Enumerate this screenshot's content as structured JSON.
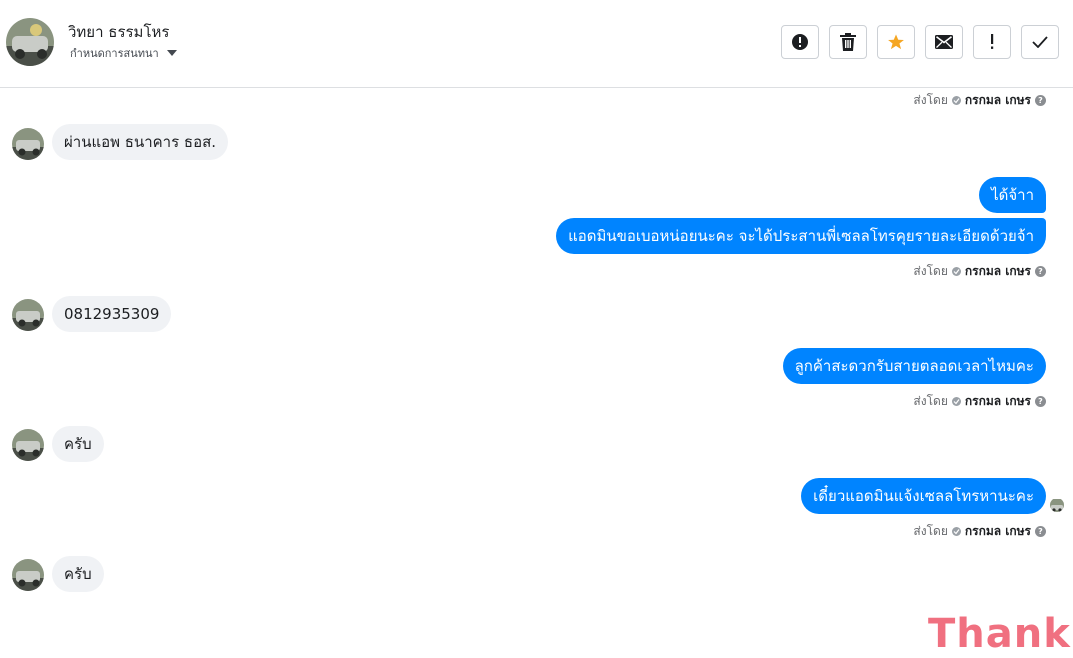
{
  "header": {
    "contact_name": "วิทยา ธรรมโหร",
    "subtitle": "กำหนดการสนทนา",
    "buttons": [
      {
        "name": "report-button",
        "icon": "alert-circle-icon"
      },
      {
        "name": "delete-button",
        "icon": "trash-icon"
      },
      {
        "name": "star-button",
        "icon": "star-icon"
      },
      {
        "name": "mark-unread-button",
        "icon": "envelope-icon"
      },
      {
        "name": "important-button",
        "icon": "exclamation-icon"
      },
      {
        "name": "mark-done-button",
        "icon": "check-icon"
      }
    ]
  },
  "sent_by": {
    "prefix": "ส่งโดย",
    "agent": "กรกมล เกษร",
    "help": "?"
  },
  "messages": {
    "m1": "ผ่านแอพ ธนาคาร ธอส.",
    "m2": "ได้จ้าา",
    "m3": "แอดมินขอเบอหน่อยนะคะ  จะได้ประสานพี่เซลลโทรคุยรายละเอียดด้วยจ้า",
    "m4": "0812935309",
    "m5": "ลูกค้าสะดวกรับสายตลอดเวลาไหมคะ",
    "m6": "ครับ",
    "m7": "เดี๋ยวแอดมินแจ้งเซลลโทรหานะคะ",
    "m8": "ครับ"
  },
  "sticker": {
    "text": "Thank"
  },
  "colors": {
    "outgoing": "#0084ff",
    "incoming": "#f0f2f5",
    "star": "#f5a623",
    "sticker": "#f07080"
  }
}
